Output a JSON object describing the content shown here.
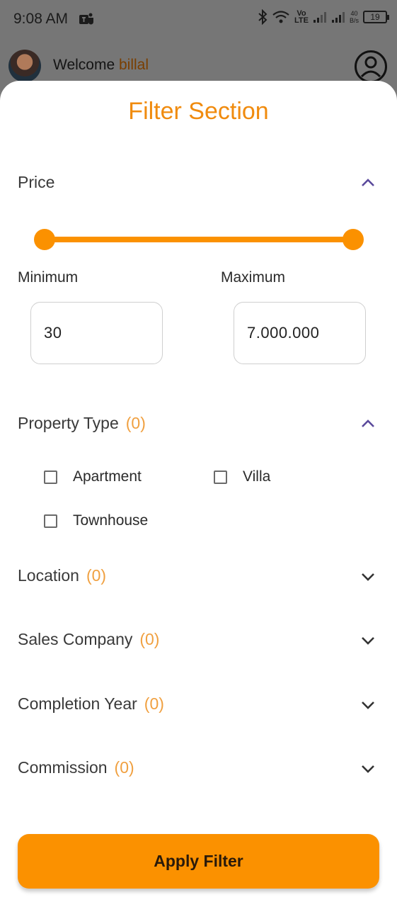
{
  "status_bar": {
    "time": "9:08 AM",
    "net_speed_value": "40",
    "net_speed_unit": "B/s",
    "network_label_top": "Vo",
    "network_label_bottom": "LTE",
    "battery": "19"
  },
  "header": {
    "welcome_text": "Welcome",
    "username": "billal"
  },
  "sheet": {
    "title": "Filter Section"
  },
  "price": {
    "title": "Price",
    "min_label": "Minimum",
    "max_label": "Maximum",
    "min_value": "30",
    "max_value": "7.000.000",
    "slider_low_fraction": 0,
    "slider_high_fraction": 1
  },
  "property_type": {
    "title": "Property Type",
    "count": "(0)",
    "options": [
      "Apartment",
      "Villa",
      "Townhouse"
    ]
  },
  "sections": [
    {
      "title": "Location",
      "count": "(0)"
    },
    {
      "title": "Sales Company",
      "count": "(0)"
    },
    {
      "title": "Completion Year",
      "count": "(0)"
    },
    {
      "title": "Commission",
      "count": "(0)"
    }
  ],
  "apply_button": "Apply Filter",
  "colors": {
    "accent": "#fb9100",
    "title": "#f08b0e",
    "count": "#f0a040",
    "chevron_active": "#5b4a9c",
    "chevron": "#333333"
  },
  "icons": {
    "teams": "teams-icon",
    "bluetooth": "bluetooth-icon",
    "wifi": "wifi-icon",
    "signal": "signal-icon",
    "battery": "battery-icon",
    "profile": "profile-icon",
    "expand": "chevron-up-icon",
    "collapse": "chevron-down-icon"
  }
}
